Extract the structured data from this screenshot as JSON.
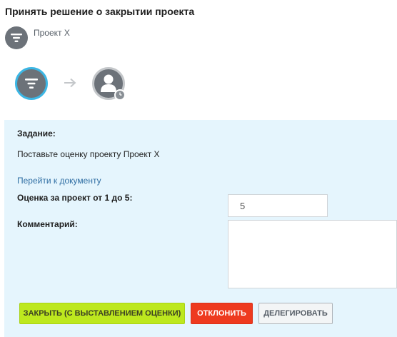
{
  "header": {
    "title": "Принять решение о закрытии проекта"
  },
  "project": {
    "name": "Проект Х",
    "icon": "funnel-filter-icon"
  },
  "workflow": {
    "steps": [
      {
        "icon": "funnel-filter-icon",
        "state": "current"
      },
      {
        "icon": "user-icon",
        "badge": "clock-icon",
        "state": "pending"
      }
    ],
    "connector_icon": "arrow-right-icon"
  },
  "task": {
    "heading": "Задание:",
    "text": "Поставьте оценку проекту Проект Х",
    "document_link": "Перейти к документу",
    "rating_label": "Оценка за проект от 1 до 5:",
    "rating_value": "5",
    "comment_label": "Комментарий:",
    "comment_value": ""
  },
  "actions": {
    "close_label": "Закрыть (с выставлением оценки)",
    "reject_label": "Отклонить",
    "delegate_label": "Делегировать"
  },
  "colors": {
    "accent_blue": "#3cb6e4",
    "panel_bg": "#e5f5fd",
    "close_button": "#bde81e",
    "reject_button": "#ee3a1f",
    "link": "#2f6ea3"
  }
}
